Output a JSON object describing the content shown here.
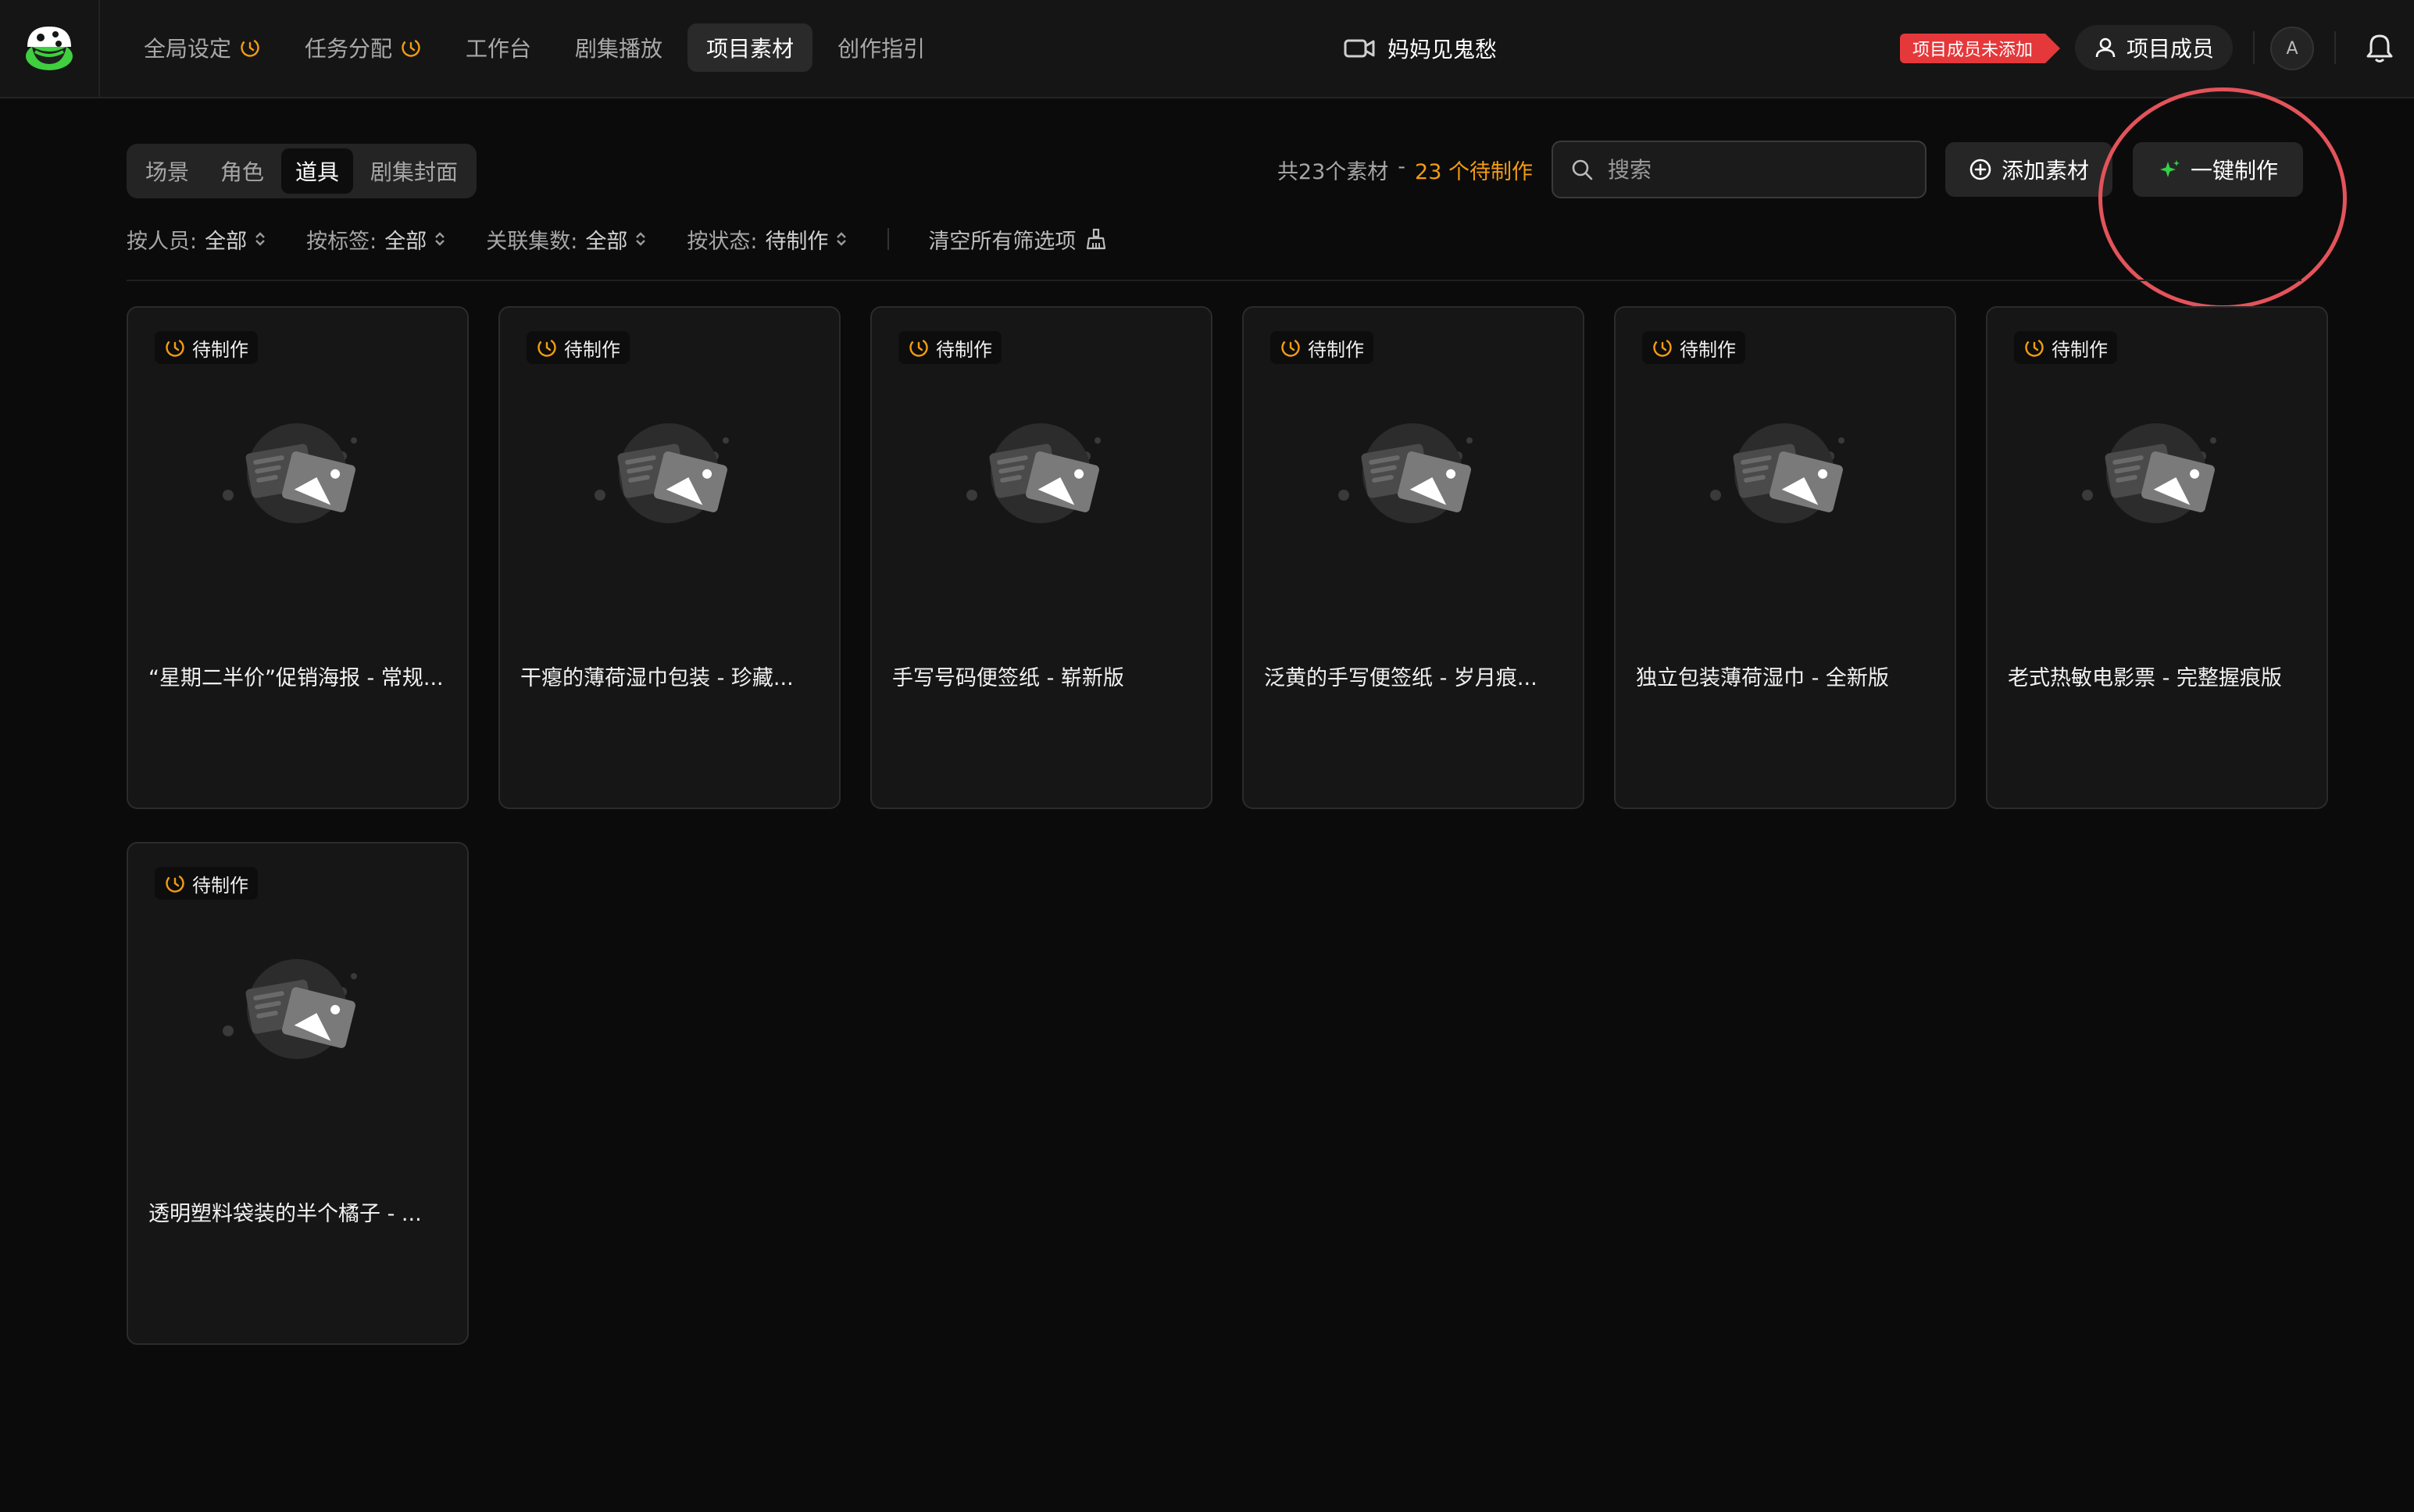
{
  "nav": {
    "items": [
      {
        "label": "全局设定",
        "has_clock": true
      },
      {
        "label": "任务分配",
        "has_clock": true
      },
      {
        "label": "工作台",
        "has_clock": false
      },
      {
        "label": "剧集播放",
        "has_clock": false
      },
      {
        "label": "项目素材",
        "has_clock": false,
        "active": true
      },
      {
        "label": "创作指引",
        "has_clock": false
      }
    ]
  },
  "project": {
    "title": "妈妈见鬼愁",
    "icon": "video-camera-icon"
  },
  "header": {
    "warning_badge": "项目成员未添加",
    "members_button": "项目成员",
    "avatar_letter": "A"
  },
  "tabs": [
    {
      "label": "场景"
    },
    {
      "label": "角色"
    },
    {
      "label": "道具",
      "active": true
    },
    {
      "label": "剧集封面"
    }
  ],
  "summary": {
    "total": "共23个素材",
    "separator": "-",
    "pending": "23 个待制作"
  },
  "search": {
    "placeholder": "搜索"
  },
  "actions": {
    "add": "添加素材",
    "one_click": "一键制作"
  },
  "filters": [
    {
      "label": "按人员:",
      "value": "全部"
    },
    {
      "label": "按标签:",
      "value": "全部"
    },
    {
      "label": "关联集数:",
      "value": "全部"
    },
    {
      "label": "按状态:",
      "value": "待制作"
    }
  ],
  "clear_filters": "清空所有筛选项",
  "cards": [
    {
      "status": "待制作",
      "title": "“星期二半价”促销海报 - 常规..."
    },
    {
      "status": "待制作",
      "title": "干瘪的薄荷湿巾包装 - 珍藏..."
    },
    {
      "status": "待制作",
      "title": "手写号码便签纸 - 崭新版"
    },
    {
      "status": "待制作",
      "title": "泛黄的手写便签纸 - 岁月痕..."
    },
    {
      "status": "待制作",
      "title": "独立包装薄荷湿巾 - 全新版"
    },
    {
      "status": "待制作",
      "title": "老式热敏电影票 - 完整握痕版"
    },
    {
      "status": "待制作",
      "title": "透明塑料袋装的半个橘子 - ..."
    }
  ],
  "colors": {
    "accent": "#f39c12",
    "warning": "#e5383b",
    "sparkle": "#35d04a",
    "highlight_circle": "#e4535a"
  }
}
